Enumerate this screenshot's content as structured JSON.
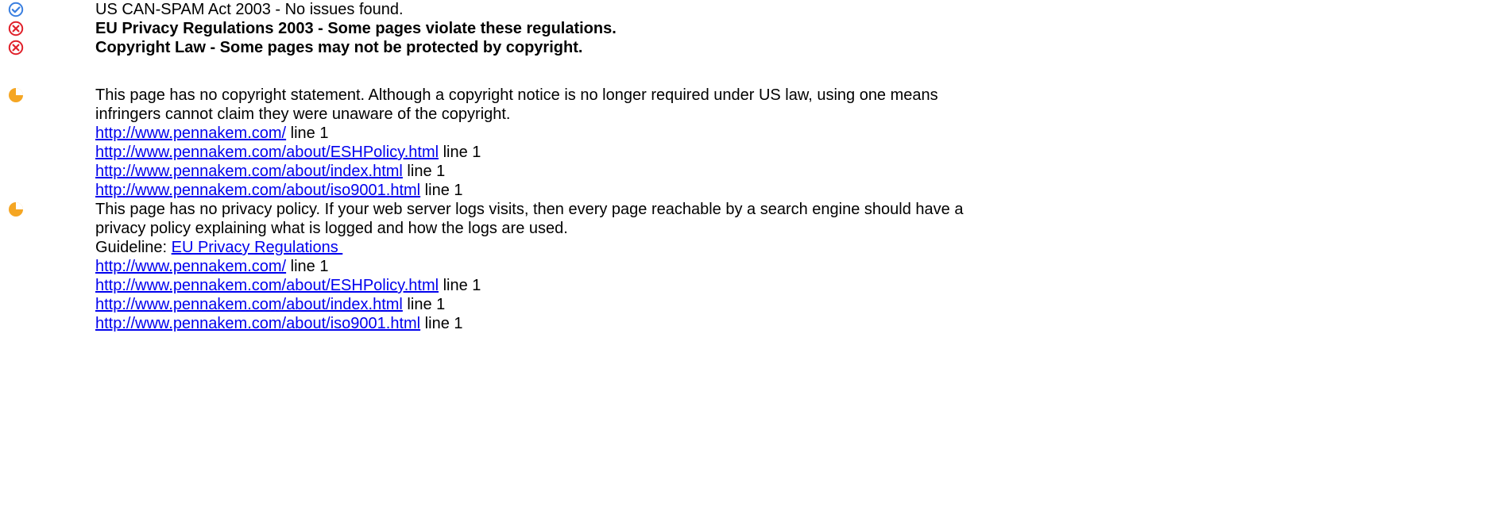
{
  "colors": {
    "pass": "#3a7fe0",
    "fail": "#e0202a",
    "warning": "#f5a623",
    "link": "#0000ee"
  },
  "summary": [
    {
      "icon": "check-circle-icon",
      "status": "pass",
      "text": "US CAN-SPAM Act 2003 - No issues found."
    },
    {
      "icon": "x-circle-icon",
      "status": "fail",
      "text": "EU Privacy Regulations 2003 - Some pages violate these regulations."
    },
    {
      "icon": "x-circle-icon",
      "status": "fail",
      "text": "Copyright Law - Some pages may not be protected by copyright."
    }
  ],
  "issues": [
    {
      "icon": "warning-pie-icon",
      "description_line1": "This page has no copyright statement. Although a copyright notice is no longer required under US law, using one means",
      "description_line2": "infringers cannot claim they were unaware of the copyright.",
      "pages": [
        {
          "url": "http://www.pennakem.com/",
          "suffix": " line 1"
        },
        {
          "url": "http://www.pennakem.com/about/ESHPolicy.html",
          "suffix": " line 1"
        },
        {
          "url": "http://www.pennakem.com/about/index.html",
          "suffix": " line 1"
        },
        {
          "url": "http://www.pennakem.com/about/iso9001.html",
          "suffix": " line 1"
        }
      ]
    },
    {
      "icon": "warning-pie-icon",
      "description_line1": "This page has no privacy policy. If your web server logs visits, then every page reachable by a search engine should have a",
      "description_line2": "privacy policy explaining what is logged and how the logs are used.",
      "guideline_label": "Guideline: ",
      "guideline_link": "EU Privacy Regulations ",
      "pages": [
        {
          "url": "http://www.pennakem.com/",
          "suffix": " line 1"
        },
        {
          "url": "http://www.pennakem.com/about/ESHPolicy.html",
          "suffix": " line 1"
        },
        {
          "url": "http://www.pennakem.com/about/index.html",
          "suffix": " line 1"
        },
        {
          "url": "http://www.pennakem.com/about/iso9001.html",
          "suffix": " line 1"
        }
      ]
    }
  ]
}
